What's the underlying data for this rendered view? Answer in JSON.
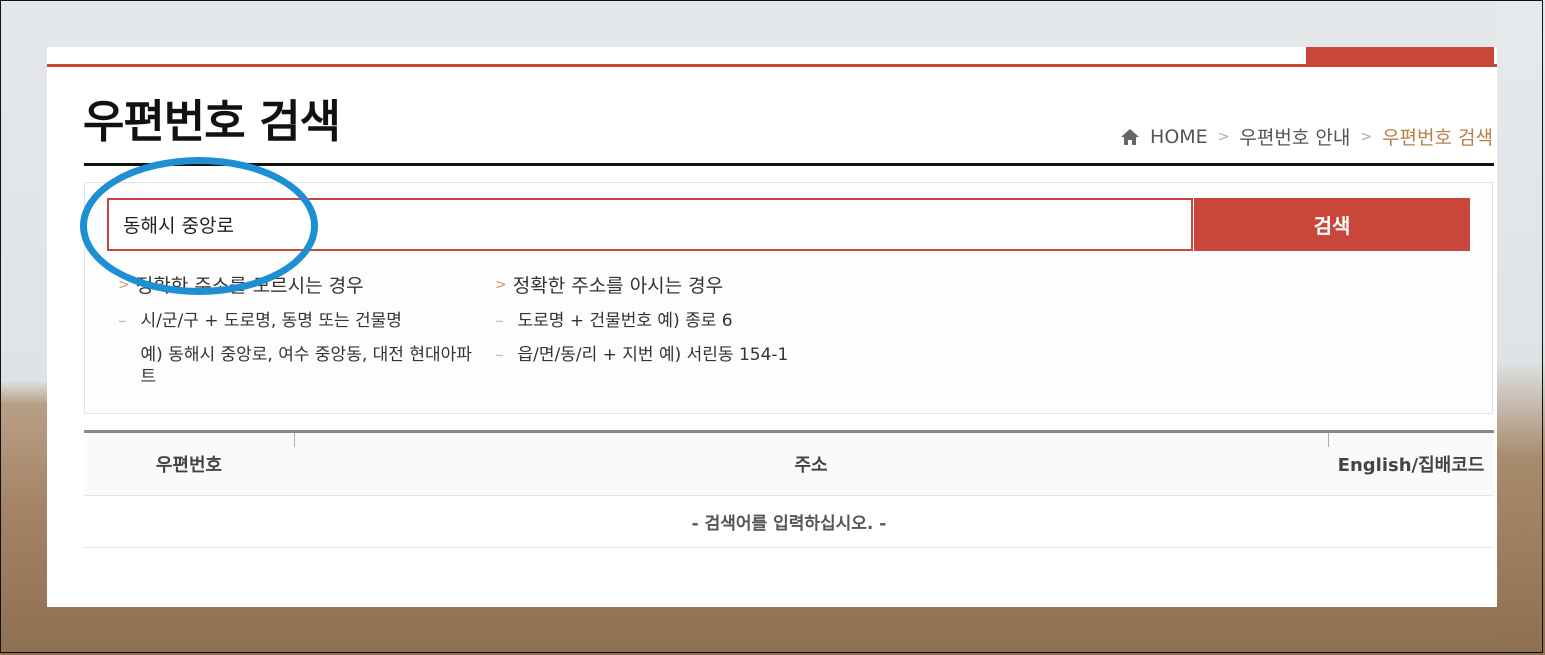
{
  "page": {
    "title": "우편번호 검색"
  },
  "breadcrumb": {
    "home": "HOME",
    "level1": "우편번호 안내",
    "current": "우편번호 검색"
  },
  "search": {
    "value": "동해시 중앙로",
    "button_label": "검색"
  },
  "help": {
    "unknown": {
      "heading": "정확한 주소를 모르시는 경우",
      "items": [
        "시/군/구 + 도로명, 동명 또는 건물명",
        "예) 동해시 중앙로, 여수 중앙동, 대전 현대아파트"
      ]
    },
    "known": {
      "heading": "정확한 주소를 아시는 경우",
      "items": [
        "도로명 + 건물번호 예) 종로 6",
        "읍/면/동/리 + 지번 예) 서린동 154-1"
      ]
    }
  },
  "table": {
    "headers": [
      "우편번호",
      "주소",
      "English/집배코드"
    ],
    "empty_message": "- 검색어를 입력하십시오. -"
  },
  "colors": {
    "accent": "#c9463a",
    "breadcrumb_current": "#b5824a",
    "annotation": "#1e8fd2"
  }
}
